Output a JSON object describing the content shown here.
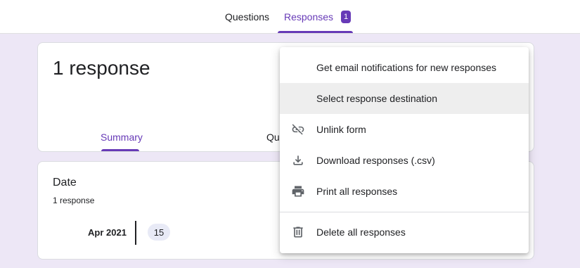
{
  "tabs": {
    "questions_label": "Questions",
    "responses_label": "Responses",
    "responses_badge": "1"
  },
  "summary_card": {
    "title": "1 response",
    "summary_tab": "Summary",
    "question_tab_partial": "Que"
  },
  "date_card": {
    "title": "Date",
    "subtitle": "1 response",
    "month": "Apr 2021",
    "day": "15"
  },
  "menu": {
    "items": [
      {
        "label": "Get email notifications for new responses",
        "icon": ""
      },
      {
        "label": "Select response destination",
        "icon": ""
      },
      {
        "label": "Unlink form",
        "icon": "link-off-icon"
      },
      {
        "label": "Download responses (.csv)",
        "icon": "download-icon"
      },
      {
        "label": "Print all responses",
        "icon": "print-icon"
      },
      {
        "label": "Delete all responses",
        "icon": "trash-icon"
      }
    ]
  },
  "colors": {
    "accent": "#673ab7",
    "background": "#ede7f6",
    "highlight": "#eeeeee"
  }
}
